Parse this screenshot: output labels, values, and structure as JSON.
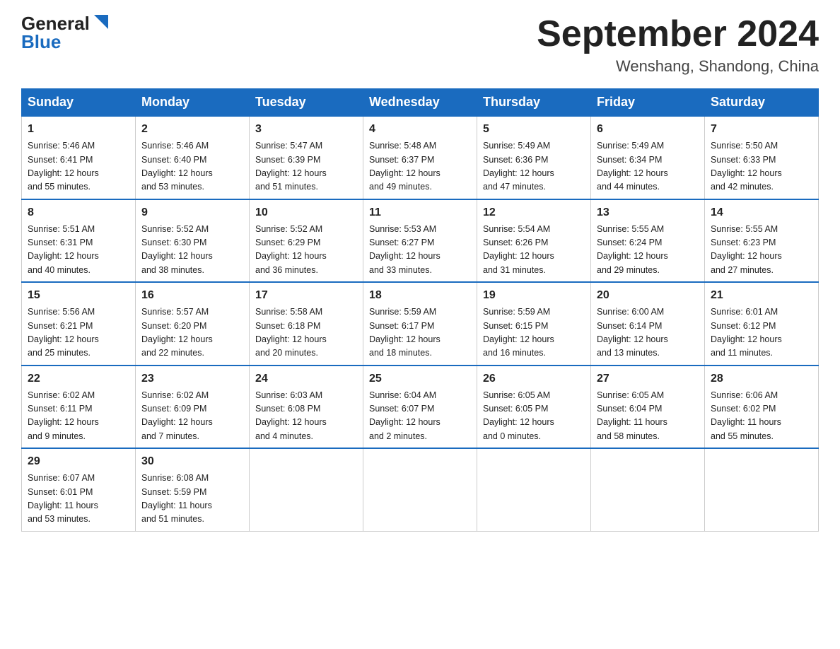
{
  "logo": {
    "general": "General",
    "blue": "Blue"
  },
  "title": "September 2024",
  "subtitle": "Wenshang, Shandong, China",
  "headers": [
    "Sunday",
    "Monday",
    "Tuesday",
    "Wednesday",
    "Thursday",
    "Friday",
    "Saturday"
  ],
  "weeks": [
    [
      {
        "day": "1",
        "info": "Sunrise: 5:46 AM\nSunset: 6:41 PM\nDaylight: 12 hours\nand 55 minutes."
      },
      {
        "day": "2",
        "info": "Sunrise: 5:46 AM\nSunset: 6:40 PM\nDaylight: 12 hours\nand 53 minutes."
      },
      {
        "day": "3",
        "info": "Sunrise: 5:47 AM\nSunset: 6:39 PM\nDaylight: 12 hours\nand 51 minutes."
      },
      {
        "day": "4",
        "info": "Sunrise: 5:48 AM\nSunset: 6:37 PM\nDaylight: 12 hours\nand 49 minutes."
      },
      {
        "day": "5",
        "info": "Sunrise: 5:49 AM\nSunset: 6:36 PM\nDaylight: 12 hours\nand 47 minutes."
      },
      {
        "day": "6",
        "info": "Sunrise: 5:49 AM\nSunset: 6:34 PM\nDaylight: 12 hours\nand 44 minutes."
      },
      {
        "day": "7",
        "info": "Sunrise: 5:50 AM\nSunset: 6:33 PM\nDaylight: 12 hours\nand 42 minutes."
      }
    ],
    [
      {
        "day": "8",
        "info": "Sunrise: 5:51 AM\nSunset: 6:31 PM\nDaylight: 12 hours\nand 40 minutes."
      },
      {
        "day": "9",
        "info": "Sunrise: 5:52 AM\nSunset: 6:30 PM\nDaylight: 12 hours\nand 38 minutes."
      },
      {
        "day": "10",
        "info": "Sunrise: 5:52 AM\nSunset: 6:29 PM\nDaylight: 12 hours\nand 36 minutes."
      },
      {
        "day": "11",
        "info": "Sunrise: 5:53 AM\nSunset: 6:27 PM\nDaylight: 12 hours\nand 33 minutes."
      },
      {
        "day": "12",
        "info": "Sunrise: 5:54 AM\nSunset: 6:26 PM\nDaylight: 12 hours\nand 31 minutes."
      },
      {
        "day": "13",
        "info": "Sunrise: 5:55 AM\nSunset: 6:24 PM\nDaylight: 12 hours\nand 29 minutes."
      },
      {
        "day": "14",
        "info": "Sunrise: 5:55 AM\nSunset: 6:23 PM\nDaylight: 12 hours\nand 27 minutes."
      }
    ],
    [
      {
        "day": "15",
        "info": "Sunrise: 5:56 AM\nSunset: 6:21 PM\nDaylight: 12 hours\nand 25 minutes."
      },
      {
        "day": "16",
        "info": "Sunrise: 5:57 AM\nSunset: 6:20 PM\nDaylight: 12 hours\nand 22 minutes."
      },
      {
        "day": "17",
        "info": "Sunrise: 5:58 AM\nSunset: 6:18 PM\nDaylight: 12 hours\nand 20 minutes."
      },
      {
        "day": "18",
        "info": "Sunrise: 5:59 AM\nSunset: 6:17 PM\nDaylight: 12 hours\nand 18 minutes."
      },
      {
        "day": "19",
        "info": "Sunrise: 5:59 AM\nSunset: 6:15 PM\nDaylight: 12 hours\nand 16 minutes."
      },
      {
        "day": "20",
        "info": "Sunrise: 6:00 AM\nSunset: 6:14 PM\nDaylight: 12 hours\nand 13 minutes."
      },
      {
        "day": "21",
        "info": "Sunrise: 6:01 AM\nSunset: 6:12 PM\nDaylight: 12 hours\nand 11 minutes."
      }
    ],
    [
      {
        "day": "22",
        "info": "Sunrise: 6:02 AM\nSunset: 6:11 PM\nDaylight: 12 hours\nand 9 minutes."
      },
      {
        "day": "23",
        "info": "Sunrise: 6:02 AM\nSunset: 6:09 PM\nDaylight: 12 hours\nand 7 minutes."
      },
      {
        "day": "24",
        "info": "Sunrise: 6:03 AM\nSunset: 6:08 PM\nDaylight: 12 hours\nand 4 minutes."
      },
      {
        "day": "25",
        "info": "Sunrise: 6:04 AM\nSunset: 6:07 PM\nDaylight: 12 hours\nand 2 minutes."
      },
      {
        "day": "26",
        "info": "Sunrise: 6:05 AM\nSunset: 6:05 PM\nDaylight: 12 hours\nand 0 minutes."
      },
      {
        "day": "27",
        "info": "Sunrise: 6:05 AM\nSunset: 6:04 PM\nDaylight: 11 hours\nand 58 minutes."
      },
      {
        "day": "28",
        "info": "Sunrise: 6:06 AM\nSunset: 6:02 PM\nDaylight: 11 hours\nand 55 minutes."
      }
    ],
    [
      {
        "day": "29",
        "info": "Sunrise: 6:07 AM\nSunset: 6:01 PM\nDaylight: 11 hours\nand 53 minutes."
      },
      {
        "day": "30",
        "info": "Sunrise: 6:08 AM\nSunset: 5:59 PM\nDaylight: 11 hours\nand 51 minutes."
      },
      {
        "day": "",
        "info": ""
      },
      {
        "day": "",
        "info": ""
      },
      {
        "day": "",
        "info": ""
      },
      {
        "day": "",
        "info": ""
      },
      {
        "day": "",
        "info": ""
      }
    ]
  ]
}
